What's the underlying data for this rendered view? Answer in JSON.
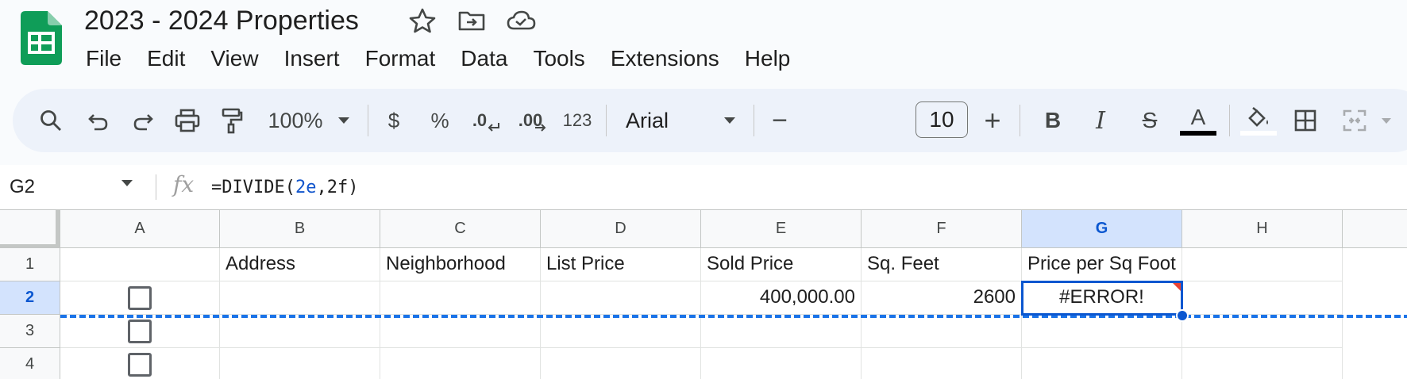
{
  "app": {
    "title": "2023 - 2024 Properties",
    "brand_color": "#0f9d58"
  },
  "title_icons": [
    "star-icon",
    "move-to-folder-icon",
    "cloud-saved-icon"
  ],
  "menu": [
    "File",
    "Edit",
    "View",
    "Insert",
    "Format",
    "Data",
    "Tools",
    "Extensions",
    "Help"
  ],
  "toolbar": {
    "zoom": "100%",
    "currency": "$",
    "percent": "%",
    "decrease_decimal": ".0",
    "increase_decimal": ".00",
    "number_format": "123",
    "font": "Arial",
    "font_size": "10",
    "minus": "−",
    "plus": "+",
    "bold": "B",
    "italic": "I",
    "strikethrough": "S",
    "text_color_label": "A",
    "text_color": "#000000"
  },
  "formula_bar": {
    "name_box": "G2",
    "fx": "fx",
    "formula_prefix": "=DIVIDE(",
    "formula_ref1": "2e",
    "formula_comma": ",",
    "formula_ref2": "2f",
    "formula_suffix": ")"
  },
  "grid": {
    "columns": [
      "A",
      "B",
      "C",
      "D",
      "E",
      "F",
      "G",
      "H"
    ],
    "rows": [
      "1",
      "2",
      "3",
      "4"
    ],
    "selected_cell": "G2",
    "row1": {
      "B": "Address",
      "C": "Neighborhood",
      "D": "List Price",
      "E": "Sold Price",
      "F": "Sq. Feet",
      "G": "Price per Sq Foot"
    },
    "row2": {
      "E": "400,000.00",
      "F": "2600",
      "G": "#ERROR!"
    },
    "checkbox_rows": [
      "2",
      "3",
      "4"
    ],
    "selection_color": "#0b57d0",
    "error_color": "#ea4335"
  }
}
